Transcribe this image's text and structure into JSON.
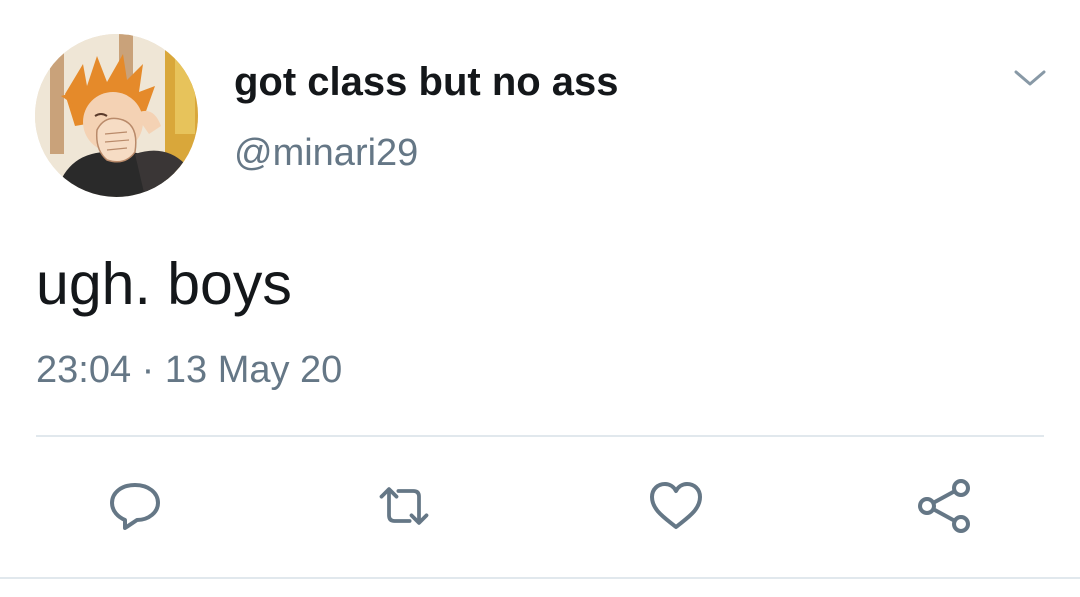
{
  "tweet": {
    "display_name": "got class but no ass",
    "handle": "@minari29",
    "text": "ugh. boys",
    "time": "23:04",
    "separator": "·",
    "date": "13 May 20"
  },
  "icons": {
    "menu": "chevron-down-icon",
    "reply": "reply-icon",
    "retweet": "retweet-icon",
    "like": "heart-icon",
    "share": "share-icon"
  },
  "colors": {
    "text_primary": "#14171a",
    "text_secondary": "#657786",
    "icon": "#657786",
    "divider": "#e1e8ed"
  }
}
